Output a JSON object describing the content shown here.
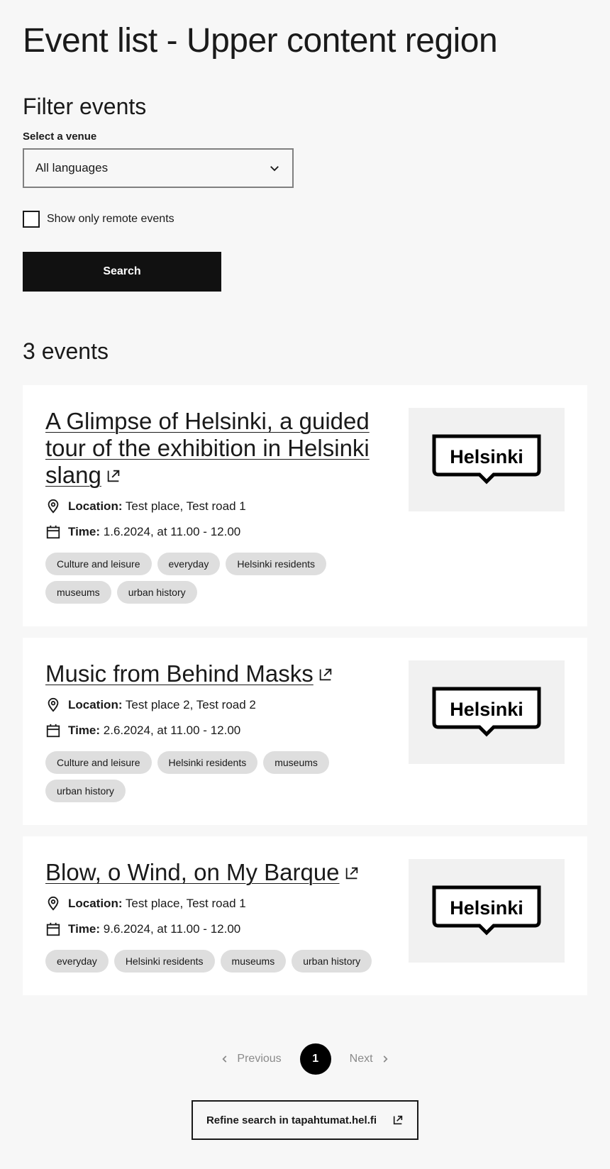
{
  "page_title": "Event list - Upper content region",
  "filter": {
    "title": "Filter events",
    "venue_label": "Select a venue",
    "venue_selected": "All languages",
    "remote_label": "Show only remote events",
    "remote_checked": false,
    "search_label": "Search"
  },
  "events_count": "3 events",
  "events": [
    {
      "title": "A Glimpse of Helsinki, a guided tour of the exhibition in Helsinki slang",
      "location_label": "Location:",
      "location": "Test place, Test road 1",
      "time_label": "Time:",
      "time": "1.6.2024, at 11.00 - 12.00",
      "tags": [
        "Culture and leisure",
        "everyday",
        "Helsinki residents",
        "museums",
        "urban history"
      ],
      "logo_text": "Helsinki"
    },
    {
      "title": "Music from Behind Masks",
      "location_label": "Location:",
      "location": "Test place 2, Test road 2",
      "time_label": "Time:",
      "time": "2.6.2024, at 11.00 - 12.00",
      "tags": [
        "Culture and leisure",
        "Helsinki residents",
        "museums",
        "urban history"
      ],
      "logo_text": "Helsinki"
    },
    {
      "title": "Blow, o Wind, on My Barque",
      "location_label": "Location:",
      "location": "Test place, Test road 1",
      "time_label": "Time:",
      "time": "9.6.2024, at 11.00 - 12.00",
      "tags": [
        "everyday",
        "Helsinki residents",
        "museums",
        "urban history"
      ],
      "logo_text": "Helsinki"
    }
  ],
  "pagination": {
    "previous_label": "Previous",
    "current_page": "1",
    "next_label": "Next"
  },
  "refine_label": "Refine search in tapahtumat.hel.fi",
  "icons": {
    "dropdown": "chevron-down-icon",
    "location": "location-pin-icon",
    "time": "calendar-icon",
    "external": "external-link-icon",
    "prev": "chevron-left-icon",
    "next": "chevron-right-icon"
  },
  "colors": {
    "background": "#f7f7f7",
    "card": "#ffffff",
    "primary_button": "#111111",
    "tag": "#dedede",
    "image_bg": "#f1f1f1"
  }
}
